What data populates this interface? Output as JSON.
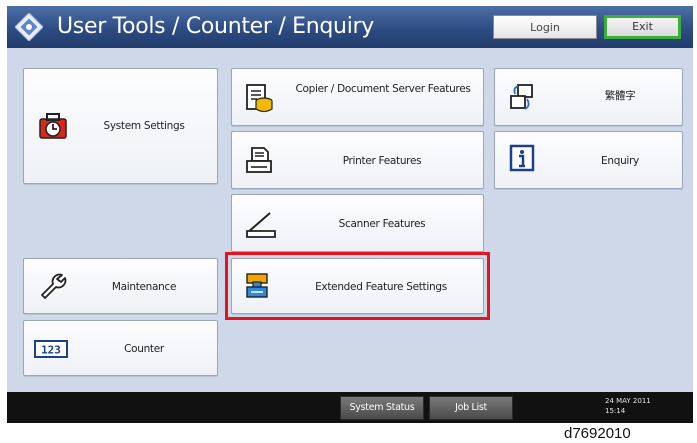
{
  "header": {
    "title": "User Tools / Counter / Enquiry",
    "login_label": "Login",
    "exit_label": "Exit",
    "icon": "diamond-compass-icon"
  },
  "buttons": {
    "system_settings": {
      "label": "System Settings",
      "icon": "toolbox-clock-icon"
    },
    "copier": {
      "label": "Copier / Document Server Features",
      "icon": "copier-stack-icon"
    },
    "language": {
      "label": "繁體字",
      "icon": "language-switch-icon"
    },
    "printer": {
      "label": "Printer Features",
      "icon": "printer-icon"
    },
    "enquiry": {
      "label": "Enquiry",
      "icon": "info-icon"
    },
    "scanner": {
      "label": "Scanner Features",
      "icon": "scanner-lid-icon"
    },
    "maintenance": {
      "label": "Maintenance",
      "icon": "wrench-icon"
    },
    "extended": {
      "label": "Extended Feature Settings",
      "icon": "extended-feature-icon"
    },
    "counter": {
      "label": "Counter",
      "icon": "counter-123-icon"
    }
  },
  "highlight_color": "#e3141c",
  "status_bar": {
    "system_status_label": "System Status",
    "job_list_label": "Job List",
    "date": "24 MAY   2011",
    "time": "15:14"
  },
  "caption": "d7692010"
}
